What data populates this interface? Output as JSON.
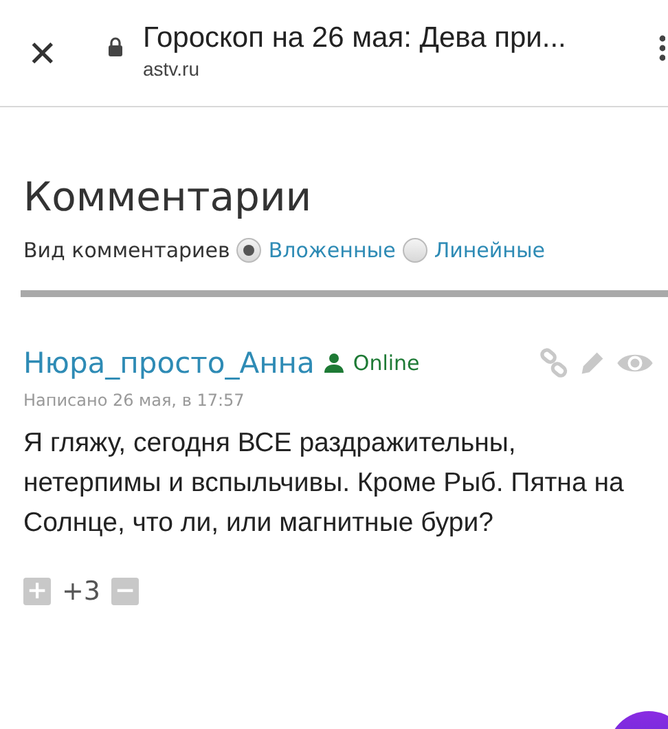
{
  "browser_bar": {
    "close": "✕",
    "title": "Гороскоп на 26 мая: Дева при...",
    "url": "astv.ru"
  },
  "comments_section": {
    "heading": "Комментарии",
    "view_label": "Вид комментариев",
    "view_options": [
      {
        "label": "Вложенные",
        "selected": true
      },
      {
        "label": "Линейные",
        "selected": false
      }
    ]
  },
  "comment": {
    "author": "Нюра_просто_Анна",
    "status": "Online",
    "date": "Написано 26 мая, в 17:57",
    "text": "Я гляжу, сегодня ВСЕ раздражительны, нетерпимы и вспыльчивы. Кроме Рыб. Пятна на Солнце, что ли, или магнитные бури?",
    "vote_plus": "+",
    "rating": "+3",
    "vote_minus": "−"
  }
}
